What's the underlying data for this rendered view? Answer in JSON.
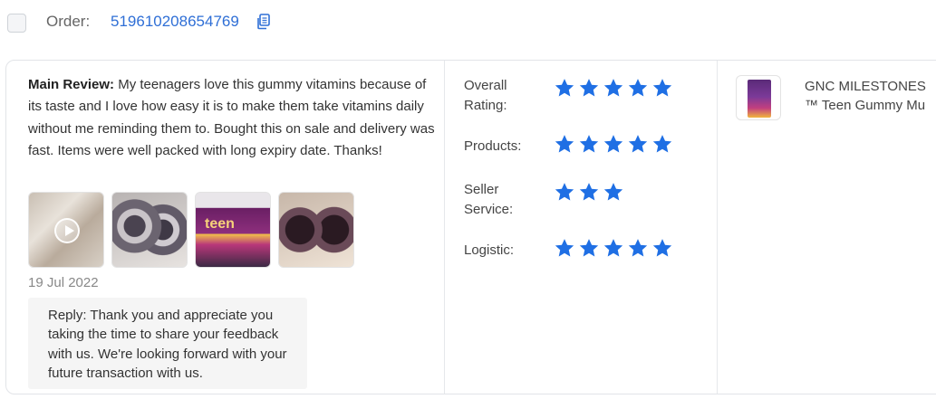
{
  "order": {
    "label": "Order:",
    "number": "519610208654769",
    "copy_icon": "copy-icon"
  },
  "review": {
    "main_label": "Main Review:",
    "text": "My teenagers love this gummy vitamins because of its taste and I love how easy it is to make them take vitamins daily without me reminding them to. Bought this on sale and delivery was fast. Items were well packed with long expiry date. Thanks!",
    "media": [
      {
        "kind": "video",
        "icon": "play-icon"
      },
      {
        "kind": "photo"
      },
      {
        "kind": "photo",
        "label": "teen"
      },
      {
        "kind": "photo"
      }
    ],
    "date": "19 Jul 2022",
    "reply": "Reply: Thank you and appreciate you taking the time to share your feedback with us. We're looking forward with your future transaction with us."
  },
  "ratings": [
    {
      "label": "Overall Rating:",
      "stars": 5
    },
    {
      "label": "Products:",
      "stars": 5
    },
    {
      "label": "Seller Service:",
      "stars": 3
    },
    {
      "label": "Logistic:",
      "stars": 5
    }
  ],
  "product": {
    "line1": "GNC MILESTONES",
    "line2": "™ Teen Gummy Mu"
  },
  "colors": {
    "accent": "#1f6fe4",
    "link": "#2f6fd6"
  }
}
